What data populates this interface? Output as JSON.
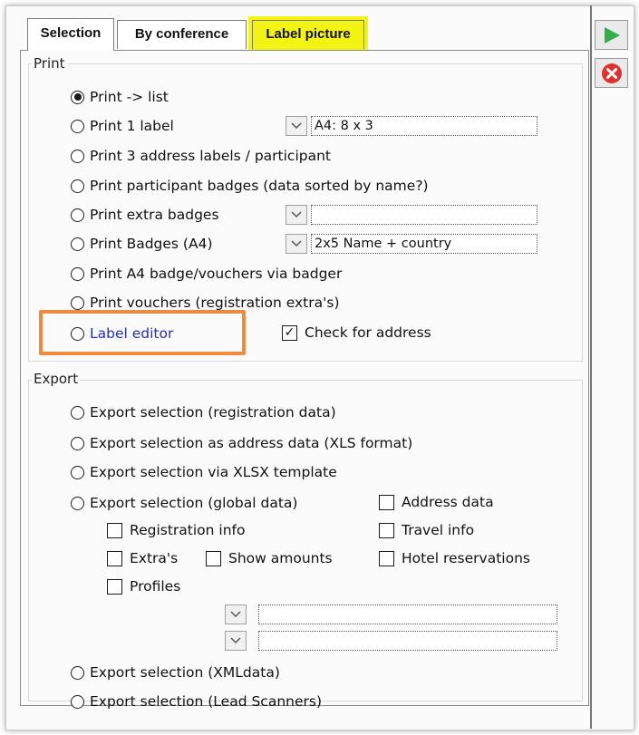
{
  "tabs": [
    {
      "label": "Selection",
      "active": true
    },
    {
      "label": "By conference",
      "active": false
    },
    {
      "label": "Label picture",
      "active": false,
      "highlighted": true
    }
  ],
  "print": {
    "title": "Print",
    "options": [
      {
        "label": "Print -> list",
        "selected": true
      },
      {
        "label": "Print 1 label",
        "selected": false
      },
      {
        "label": "Print 3 address labels / participant",
        "selected": false
      },
      {
        "label": "Print participant badges (data sorted by name?)",
        "selected": false
      },
      {
        "label": "Print extra badges",
        "selected": false
      },
      {
        "label": "Print Badges (A4)",
        "selected": false
      },
      {
        "label": "Print A4 badge/vouchers via badger",
        "selected": false
      },
      {
        "label": "Print vouchers (registration extra's)",
        "selected": false
      },
      {
        "label": "Label editor",
        "selected": false
      }
    ],
    "label_format_value": "A4: 8 x 3",
    "extra_badges_value": "",
    "badges_a4_value": "2x5 Name + country",
    "check_for_address": {
      "label": "Check for address",
      "checked": true
    }
  },
  "export": {
    "title": "Export",
    "options": [
      {
        "label": "Export selection (registration data)"
      },
      {
        "label": "Export selection as address data (XLS format)"
      },
      {
        "label": "Export selection via XLSX template"
      },
      {
        "label": "Export selection (global data)"
      },
      {
        "label": "Export selection (XMLdata)"
      },
      {
        "label": "Export selection (Lead Scanners)"
      }
    ],
    "checkboxes": {
      "address_data": "Address data",
      "registration_info": "Registration info",
      "travel_info": "Travel info",
      "extras": "Extra's",
      "show_amounts": "Show amounts",
      "hotel_reservations": "Hotel reservations",
      "profiles": "Profiles"
    },
    "dropdown1_value": "",
    "dropdown2_value": ""
  },
  "side": {
    "run_icon": "play-icon",
    "cancel_icon": "close-circle-icon",
    "colors": {
      "run": "#2fae4a",
      "cancel": "#e03131",
      "highlight": "#f4f414",
      "annotation": "#f08a3c",
      "label_editor_text": "#1f2bd6"
    }
  }
}
